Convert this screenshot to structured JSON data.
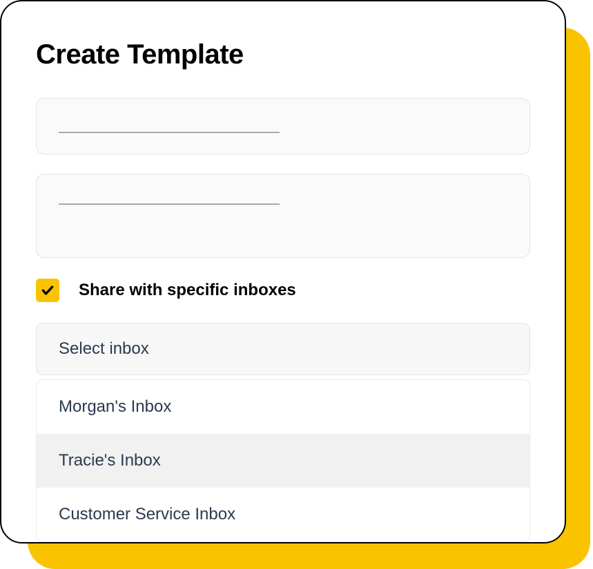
{
  "title": "Create Template",
  "checkbox": {
    "checked": true,
    "label": "Share with specific inboxes"
  },
  "select": {
    "placeholder": "Select inbox"
  },
  "options": [
    {
      "label": "Morgan's Inbox",
      "hovered": false
    },
    {
      "label": "Tracie's Inbox",
      "hovered": true
    },
    {
      "label": "Customer Service Inbox",
      "hovered": false
    }
  ]
}
